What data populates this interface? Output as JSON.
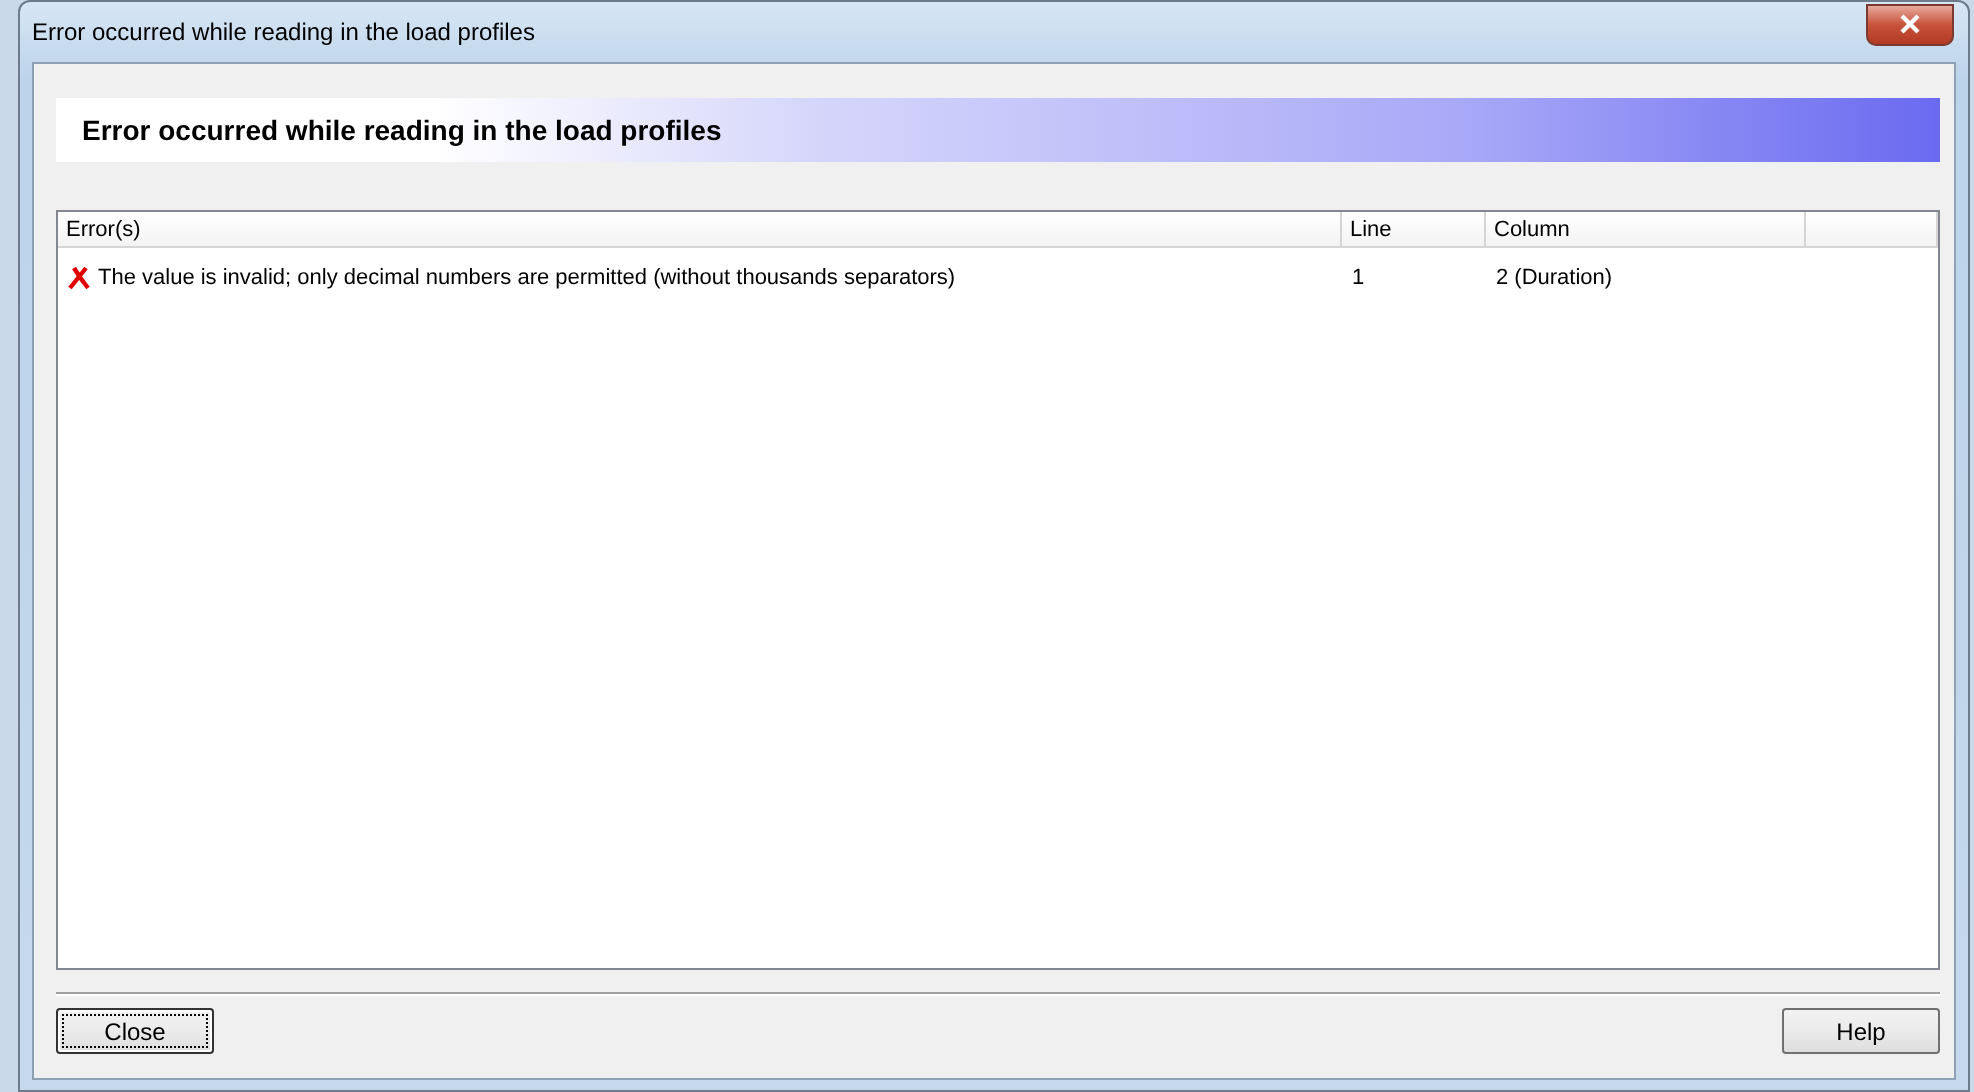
{
  "window": {
    "title": "Error occurred while reading in the load profiles"
  },
  "banner": {
    "title": "Error occurred while reading in the load profiles"
  },
  "table": {
    "columns": [
      "Error(s)",
      "Line",
      "Column"
    ],
    "rows": [
      {
        "kind": "error",
        "message": "The value is invalid; only decimal numbers are permitted (without thousands separators)",
        "line": "1",
        "column": "2 (Duration)"
      }
    ]
  },
  "buttons": [
    {
      "label": "Close",
      "focused": true
    },
    {
      "label": "Help",
      "focused": false
    }
  ]
}
